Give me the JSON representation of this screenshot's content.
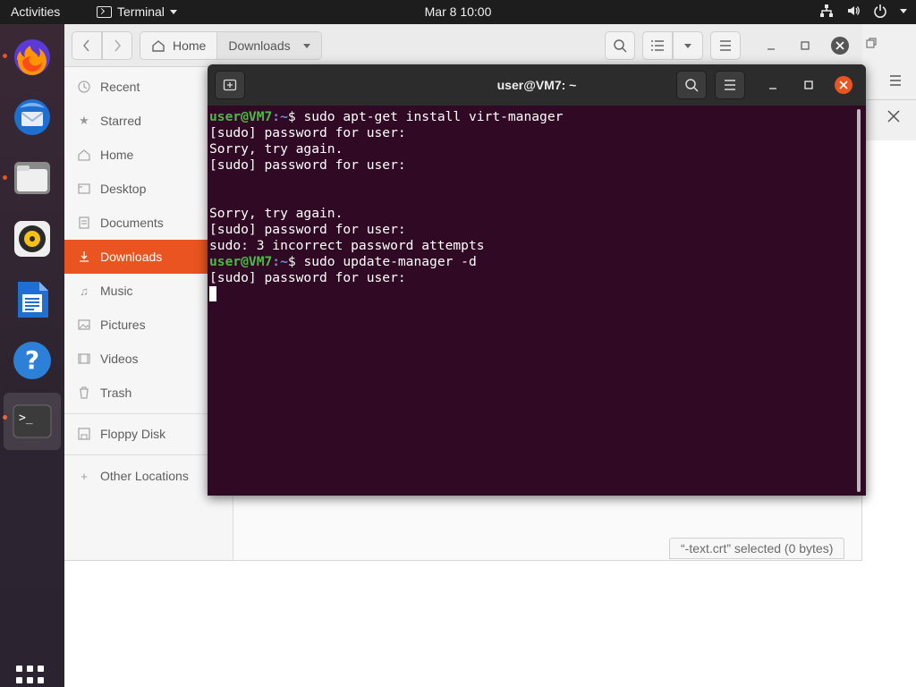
{
  "topbar": {
    "activities": "Activities",
    "app_name": "Terminal",
    "clock": "Mar 8  10:00"
  },
  "dock": {
    "items": [
      "firefox-icon",
      "thunderbird-icon",
      "files-icon",
      "rhythmbox-icon",
      "libreoffice-writer-icon",
      "help-icon",
      "terminal-icon"
    ],
    "show_apps": "grid-icon"
  },
  "files": {
    "path_home": "Home",
    "path_current": "Downloads",
    "sidebar": [
      {
        "label": "Recent",
        "icon": "clock-icon"
      },
      {
        "label": "Starred",
        "icon": "star-icon"
      },
      {
        "label": "Home",
        "icon": "home-icon"
      },
      {
        "label": "Desktop",
        "icon": "desktop-icon"
      },
      {
        "label": "Documents",
        "icon": "document-icon"
      },
      {
        "label": "Downloads",
        "icon": "download-icon"
      },
      {
        "label": "Music",
        "icon": "music-icon"
      },
      {
        "label": "Pictures",
        "icon": "picture-icon"
      },
      {
        "label": "Videos",
        "icon": "video-icon"
      },
      {
        "label": "Trash",
        "icon": "trash-icon"
      }
    ],
    "floppy": "Floppy Disk",
    "other_locations": "Other Locations",
    "status": "“-text.crt” selected  (0 bytes)"
  },
  "terminal": {
    "title": "user@VM7: ~",
    "prompt_user": "user@VM7",
    "prompt_path": ":~",
    "prompt_sign": "$ ",
    "lines": [
      {
        "type": "cmd",
        "text": "sudo apt-get install virt-manager"
      },
      {
        "type": "out",
        "text": "[sudo] password for user:"
      },
      {
        "type": "out",
        "text": "Sorry, try again."
      },
      {
        "type": "out",
        "text": "[sudo] password for user:"
      },
      {
        "type": "out",
        "text": ""
      },
      {
        "type": "out",
        "text": ""
      },
      {
        "type": "out",
        "text": "Sorry, try again."
      },
      {
        "type": "out",
        "text": "[sudo] password for user:"
      },
      {
        "type": "out",
        "text": "sudo: 3 incorrect password attempts"
      },
      {
        "type": "cmd",
        "text": "sudo update-manager -d"
      },
      {
        "type": "out",
        "text": "[sudo] password for user:"
      },
      {
        "type": "cursor",
        "text": ""
      }
    ]
  },
  "colors": {
    "accent": "#e95420",
    "terminal_bg": "#300a24",
    "prompt_user": "#4fb84a",
    "prompt_path": "#6f8fcf"
  }
}
